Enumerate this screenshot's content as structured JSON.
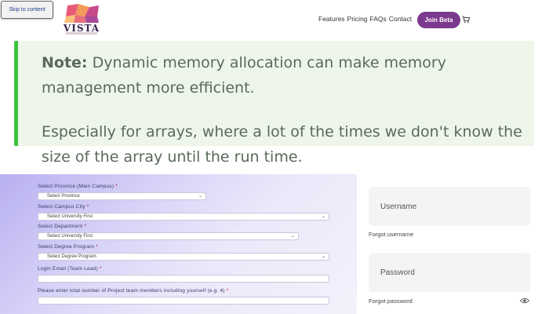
{
  "header": {
    "skip_link": "Skip to content",
    "logo_text": "VISTA",
    "nav": [
      "Features",
      "Pricing",
      "FAQs",
      "Contact"
    ],
    "join_button": "Join Beta",
    "cart_icon": "cart-icon"
  },
  "note": {
    "label": "Note:",
    "paragraph1": "Dynamic memory allocation can make memory management more efficient.",
    "paragraph2": "Especially for arrays, where a lot of the times we don't know the size of the array until the run time."
  },
  "form": {
    "fields": [
      {
        "label": "Select Province (Main Campus)",
        "required": "*",
        "value": "Select Province"
      },
      {
        "label": "Select Campus City",
        "required": "*",
        "value": "Select University First"
      },
      {
        "label": "Select Department",
        "required": "*",
        "value": "Select University First"
      },
      {
        "label": "Select Degree Program",
        "required": "*",
        "value": "Select Degree Program"
      },
      {
        "label": "Login Email (Team Lead)",
        "required": "*",
        "value": ""
      },
      {
        "label": "Please enter total number of Project team members including yourself (e.g. 4)",
        "required": "*",
        "value": ""
      }
    ]
  },
  "login": {
    "username_placeholder": "Username",
    "forgot_username": "Forgot username",
    "password_placeholder": "Password",
    "forgot_password": "Forgot password"
  },
  "colors": {
    "accent": "#7b3a8e",
    "note_border": "#3ec33e",
    "note_bg": "#eef6ea"
  }
}
